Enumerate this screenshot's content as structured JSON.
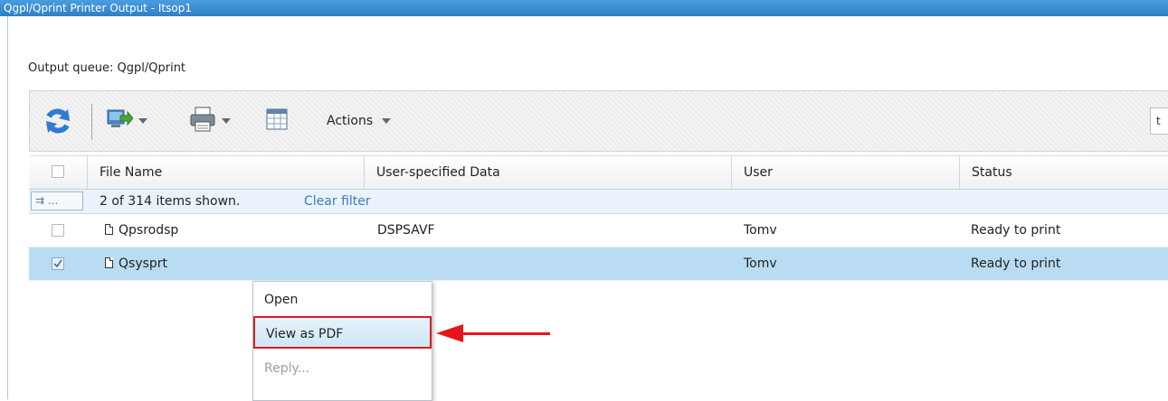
{
  "window": {
    "title": "Qgpl/Qprint Printer Output - Itsop1"
  },
  "queue": {
    "label": "Output queue: Qgpl/Qprint"
  },
  "toolbar": {
    "actions_label": "Actions",
    "search_partial": "t"
  },
  "table": {
    "columns": [
      "File Name",
      "User-specified Data",
      "User",
      "Status"
    ],
    "filter_button": "⇉ ...",
    "filter_text": "2 of 314 items shown.",
    "clear_filter": "Clear filter",
    "rows": [
      {
        "file": "Qpsrodsp",
        "data": "DSPSAVF",
        "user": "Tomv",
        "status": "Ready to print",
        "selected": false
      },
      {
        "file": "Qsysprt",
        "data": "",
        "user": "Tomv",
        "status": "Ready to print",
        "selected": true
      }
    ]
  },
  "context_menu": {
    "items": [
      "Open",
      "View as PDF",
      "Reply..."
    ]
  },
  "colors": {
    "title_bar": "#2f7fc4",
    "selected_row": "#b9dcf2",
    "callout": "#e8141b"
  }
}
